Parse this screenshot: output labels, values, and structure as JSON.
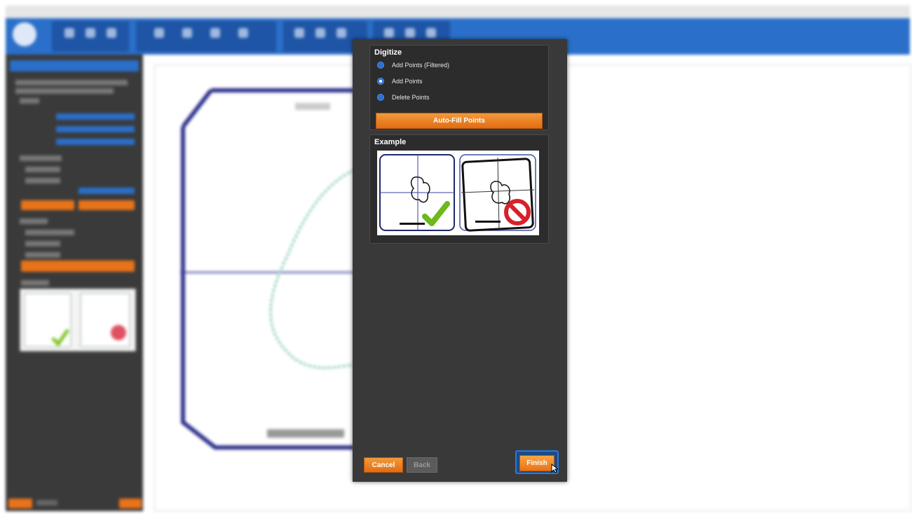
{
  "dialog": {
    "digitize": {
      "title": "Digitize",
      "options": [
        {
          "label": "Add Points (Filtered)",
          "selected": false
        },
        {
          "label": "Add Points",
          "selected": true
        },
        {
          "label": "Delete Points",
          "selected": false
        }
      ],
      "autofill_label": "Auto-Fill Points"
    },
    "example": {
      "title": "Example",
      "good_marker": "check-icon",
      "bad_marker": "prohibited-icon"
    },
    "buttons": {
      "cancel": "Cancel",
      "back": "Back",
      "finish": "Finish"
    }
  },
  "colors": {
    "accent_orange": "#e8731a",
    "accent_blue": "#2a6fc9",
    "dialog_bg": "#393939",
    "ok_green": "#7cc21f",
    "stop_red": "#d8202a"
  }
}
